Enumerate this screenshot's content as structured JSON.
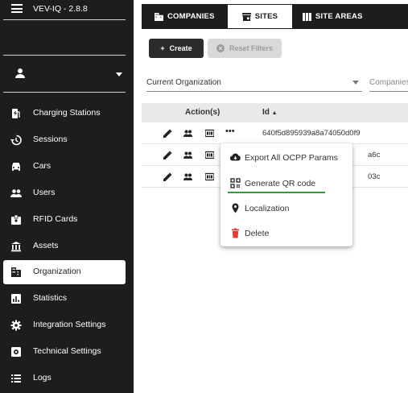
{
  "app": {
    "title": "VEV-IQ - 2.8.8"
  },
  "sidebar": {
    "items": [
      {
        "label": "Charging Stations",
        "icon": "charging-station-icon"
      },
      {
        "label": "Sessions",
        "icon": "history-icon"
      },
      {
        "label": "Cars",
        "icon": "car-icon"
      },
      {
        "label": "Users",
        "icon": "users-icon"
      },
      {
        "label": "RFID Cards",
        "icon": "badge-icon"
      },
      {
        "label": "Assets",
        "icon": "bank-icon"
      },
      {
        "label": "Organization",
        "icon": "building-icon",
        "active": true
      },
      {
        "label": "Statistics",
        "icon": "chart-icon"
      },
      {
        "label": "Integration Settings",
        "icon": "gear-icon"
      },
      {
        "label": "Technical Settings",
        "icon": "settings-box-icon"
      },
      {
        "label": "Logs",
        "icon": "list-icon"
      }
    ]
  },
  "tabs": [
    {
      "label": "COMPANIES",
      "icon": "building-icon"
    },
    {
      "label": "SITES",
      "icon": "store-icon",
      "active": true
    },
    {
      "label": "SITE AREAS",
      "icon": "columns-icon"
    }
  ],
  "toolbar": {
    "create_label": "Create",
    "reset_label": "Reset Filters"
  },
  "filters": {
    "organization": "Current Organization",
    "companies": "Companies"
  },
  "table": {
    "headers": {
      "actions": "Action(s)",
      "id": "Id"
    },
    "rows": [
      {
        "id": "640f5d895939a8a74050d0f9"
      },
      {
        "id": "a6c"
      },
      {
        "id": "03c"
      }
    ]
  },
  "context_menu": {
    "items": [
      {
        "label": "Export All OCPP Params",
        "icon": "cloud-download-icon"
      },
      {
        "label": "Generate QR code",
        "icon": "qr-code-icon"
      },
      {
        "label": "Localization",
        "icon": "location-pin-icon"
      },
      {
        "label": "Delete",
        "icon": "trash-icon"
      }
    ]
  },
  "colors": {
    "sidebar_bg": "#1d1d1d",
    "accent_green": "#2e9e3a",
    "delete_red": "#e53935"
  }
}
